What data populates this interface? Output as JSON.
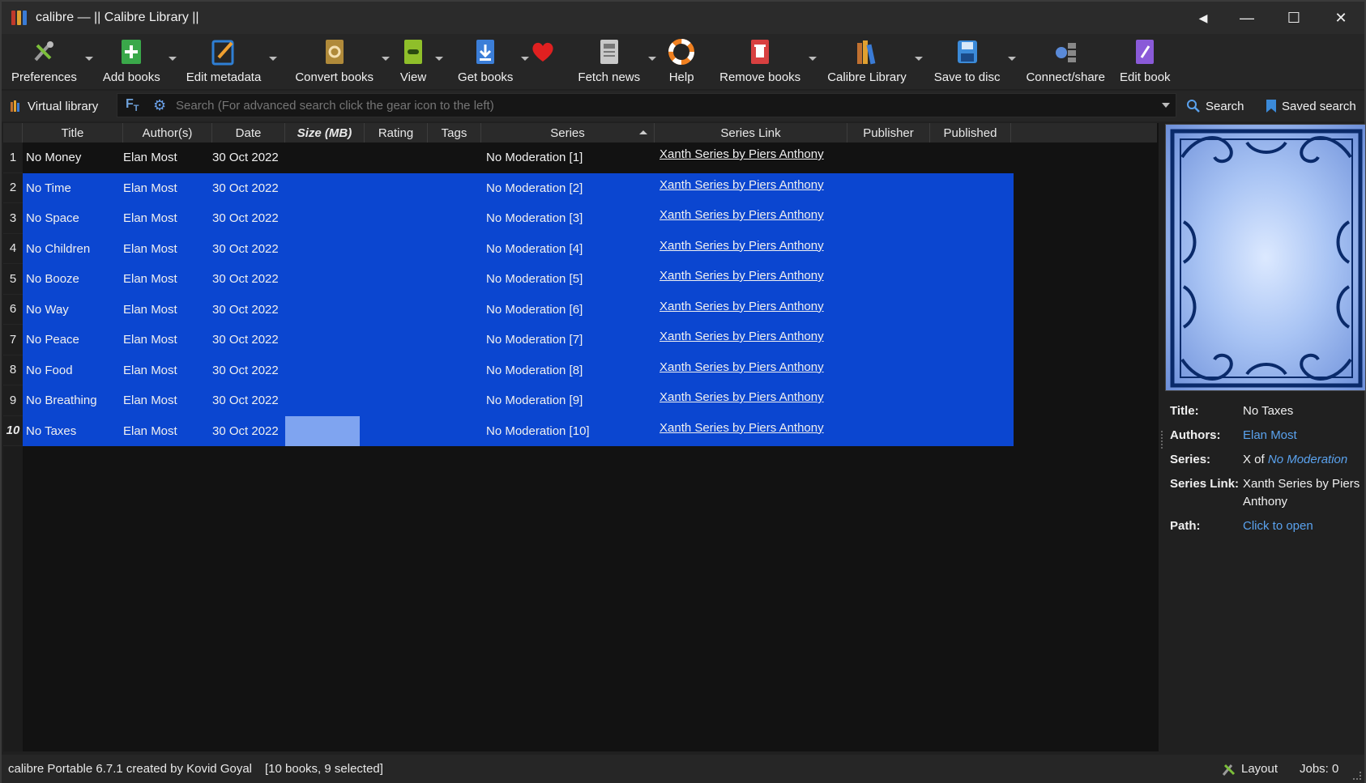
{
  "window": {
    "title": "calibre — || Calibre Library ||",
    "controls": {
      "back": "◀",
      "minimize": "—",
      "maximize": "☐",
      "close": "✕"
    }
  },
  "toolbar": {
    "items": [
      {
        "label": "Preferences",
        "icon": "preferences-icon",
        "color": "#7cbf3a"
      },
      {
        "label": "Add books",
        "icon": "add-books-icon",
        "color": "#3aa84a"
      },
      {
        "label": "Edit metadata",
        "icon": "edit-metadata-icon",
        "color": "#2f7fd4"
      },
      {
        "label": "Convert books",
        "icon": "convert-books-icon",
        "color": "#b08a3a"
      },
      {
        "label": "View",
        "icon": "view-icon",
        "color": "#8fbf2a"
      },
      {
        "label": "Get books",
        "icon": "get-books-icon",
        "color": "#3b7ed8"
      },
      {
        "label": "Fetch news",
        "icon": "fetch-news-icon",
        "color": "#c0c0c0"
      },
      {
        "label": "Help",
        "icon": "help-icon",
        "color": "#f08020"
      },
      {
        "label": "Remove books",
        "icon": "remove-books-icon",
        "color": "#d84040"
      },
      {
        "label": "Calibre Library",
        "icon": "calibre-library-icon",
        "color": "#c07030"
      },
      {
        "label": "Save to disc",
        "icon": "save-to-disc-icon",
        "color": "#3b8ad8"
      },
      {
        "label": "Connect/share",
        "icon": "connect-share-icon",
        "color": "#5a8ad8"
      },
      {
        "label": "Edit book",
        "icon": "edit-book-icon",
        "color": "#8a5ad8"
      }
    ],
    "donate_icon": "heart-icon"
  },
  "searchbar": {
    "virtual_library": "Virtual library",
    "placeholder": "Search (For advanced search click the gear icon to the left)",
    "search_label": "Search",
    "saved_search_label": "Saved search"
  },
  "table": {
    "columns": [
      "Title",
      "Author(s)",
      "Date",
      "Size (MB)",
      "Rating",
      "Tags",
      "Series",
      "Series Link",
      "Publisher",
      "Published"
    ],
    "sorted_column": "Series",
    "rows": [
      {
        "num": "1",
        "title": "No Money",
        "author": "Elan Most",
        "date": "30 Oct 2022",
        "series": "No Moderation [1]",
        "series_link": "Xanth Series by Piers Anthony",
        "selected": false
      },
      {
        "num": "2",
        "title": "No Time",
        "author": "Elan Most",
        "date": "30 Oct 2022",
        "series": "No Moderation [2]",
        "series_link": "Xanth Series by Piers Anthony",
        "selected": true
      },
      {
        "num": "3",
        "title": "No Space",
        "author": "Elan Most",
        "date": "30 Oct 2022",
        "series": "No Moderation [3]",
        "series_link": "Xanth Series by Piers Anthony",
        "selected": true
      },
      {
        "num": "4",
        "title": "No Children",
        "author": "Elan Most",
        "date": "30 Oct 2022",
        "series": "No Moderation [4]",
        "series_link": "Xanth Series by Piers Anthony",
        "selected": true
      },
      {
        "num": "5",
        "title": "No Booze",
        "author": "Elan Most",
        "date": "30 Oct 2022",
        "series": "No Moderation [5]",
        "series_link": "Xanth Series by Piers Anthony",
        "selected": true
      },
      {
        "num": "6",
        "title": "No Way",
        "author": "Elan Most",
        "date": "30 Oct 2022",
        "series": "No Moderation [6]",
        "series_link": "Xanth Series by Piers Anthony",
        "selected": true
      },
      {
        "num": "7",
        "title": "No Peace",
        "author": "Elan Most",
        "date": "30 Oct 2022",
        "series": "No Moderation [7]",
        "series_link": "Xanth Series by Piers Anthony",
        "selected": true
      },
      {
        "num": "8",
        "title": "No Food",
        "author": "Elan Most",
        "date": "30 Oct 2022",
        "series": "No Moderation [8]",
        "series_link": "Xanth Series by Piers Anthony",
        "selected": true
      },
      {
        "num": "9",
        "title": "No Breathing",
        "author": "Elan Most",
        "date": "30 Oct 2022",
        "series": "No Moderation [9]",
        "series_link": "Xanth Series by Piers Anthony",
        "selected": true
      },
      {
        "num": "10",
        "title": "No Taxes",
        "author": "Elan Most",
        "date": "30 Oct 2022",
        "series": "No Moderation [10]",
        "series_link": "Xanth Series by Piers Anthony",
        "selected": true,
        "current": true
      }
    ]
  },
  "details": {
    "title_key": "Title:",
    "title_val": "No Taxes",
    "authors_key": "Authors:",
    "authors_val": "Elan Most",
    "series_key": "Series:",
    "series_prefix": "X of",
    "series_val": "No Moderation",
    "series_link_key": "Series Link:",
    "series_link_val": "Xanth Series by Piers Anthony",
    "path_key": "Path:",
    "path_val": "Click to open"
  },
  "status": {
    "left": "calibre Portable 6.7.1 created by Kovid Goyal",
    "selection": "[10 books, 9 selected]",
    "layout": "Layout",
    "jobs": "Jobs: 0"
  },
  "colors": {
    "selection": "#0b46d0",
    "current_cell": "#7fa4f0",
    "link": "#5aa2ee"
  }
}
